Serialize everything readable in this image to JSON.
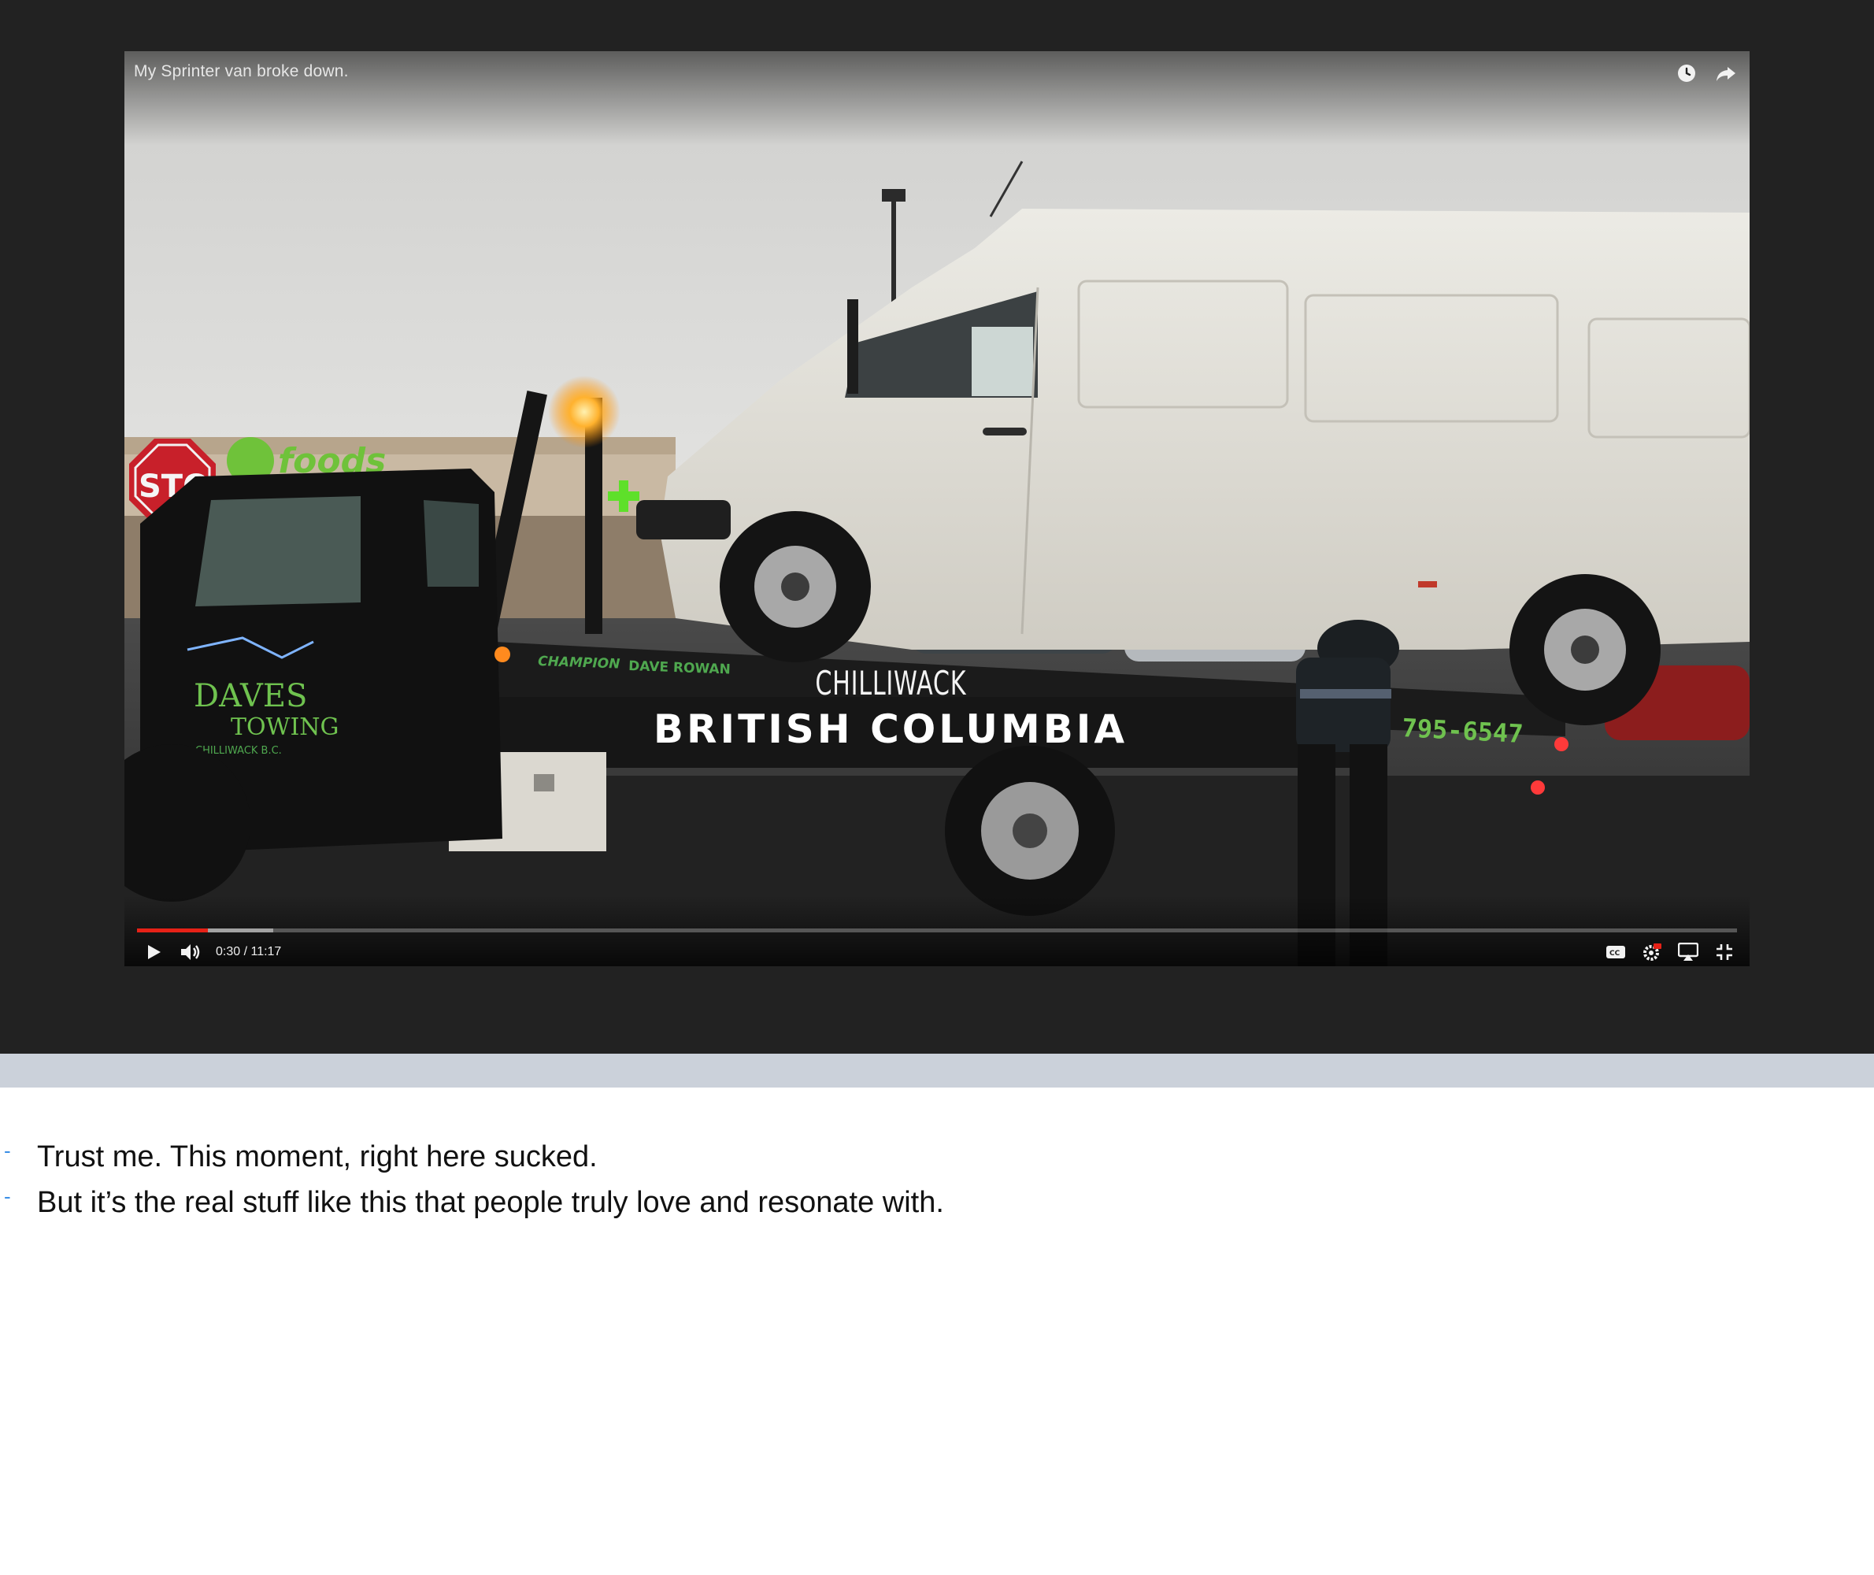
{
  "video": {
    "title": "My Sprinter van broke down.",
    "overlay_city": "CHILLIWACK",
    "overlay_region": "BRITISH COLUMBIA",
    "truck_door_text": [
      "DAVES",
      "TOWING",
      "CHILLIWACK B.C."
    ],
    "deck_text": [
      "CHAMPION",
      "DAVE ROWAN"
    ],
    "phone_fragment": "795-6547",
    "time_display": "0:30 / 11:17",
    "played_fraction": 0.0444,
    "buffered_fraction": 0.085,
    "progress_color": "#e62117",
    "top_icons": [
      "watch-later-icon",
      "share-icon"
    ],
    "left_controls": [
      "play-icon",
      "volume-icon"
    ],
    "right_controls": [
      "captions-icon",
      "settings-icon",
      "airplay-icon",
      "exit-fullscreen-icon"
    ]
  },
  "notes": [
    "Trust me. This moment, right here sucked.",
    "But it’s the real stuff like this that people truly love and resonate with."
  ],
  "colors": {
    "stage_background": "#222222",
    "divider": "#cbd1da",
    "bullet": "#3a8ee6"
  }
}
